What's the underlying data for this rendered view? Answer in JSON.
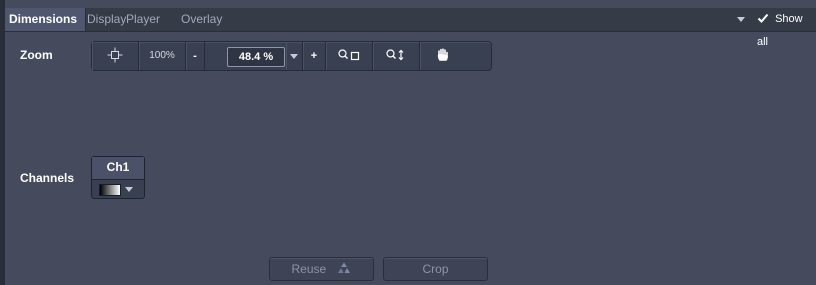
{
  "tabs": [
    {
      "label": "Dimensions",
      "active": true
    },
    {
      "label": "Display",
      "active": false
    },
    {
      "label": "Player",
      "active": false
    },
    {
      "label": "Overlay",
      "active": false
    }
  ],
  "show_all": {
    "label": "Show all",
    "checked": true
  },
  "zoom": {
    "label": "Zoom",
    "fit_icon": "crosshair-move-icon",
    "hundred_label": "100%",
    "minus_label": "-",
    "value": "48.4 %",
    "plus_label": "+",
    "zoom_rect_icon": "zoom-rectangle-icon",
    "zoom_vertical_icon": "zoom-vertical-icon",
    "pan_icon": "hand-icon"
  },
  "channels": {
    "label": "Channels",
    "items": [
      {
        "name": "Ch1",
        "lut": "grayscale"
      }
    ]
  },
  "buttons": {
    "reuse_label": "Reuse",
    "crop_label": "Crop"
  },
  "colors": {
    "background": "#454b5c",
    "tab_active": "#4f5670",
    "toolbar": "#394051"
  }
}
